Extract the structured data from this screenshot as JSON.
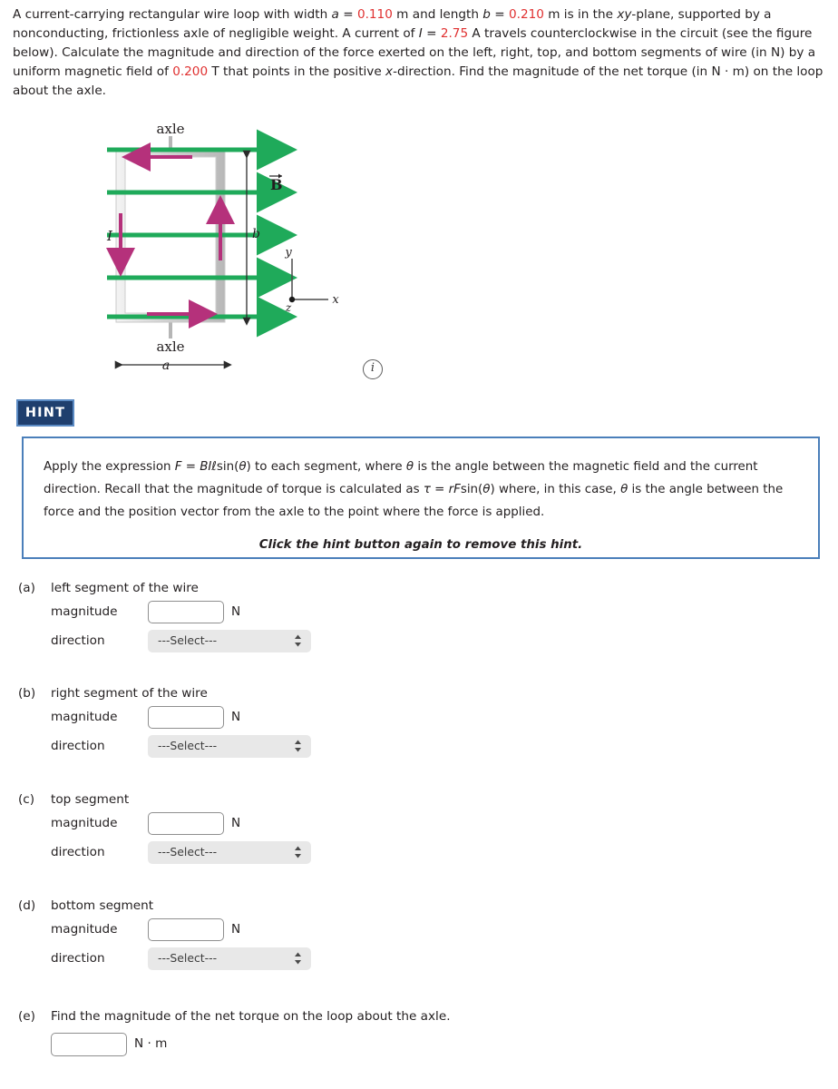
{
  "problem": {
    "segments": [
      {
        "t": "A current-carrying rectangular wire loop with width ",
        "s": "plain"
      },
      {
        "t": "a",
        "s": "ital"
      },
      {
        "t": " = ",
        "s": "plain"
      },
      {
        "t": "0.110",
        "s": "val"
      },
      {
        "t": " m and length ",
        "s": "plain"
      },
      {
        "t": "b",
        "s": "ital"
      },
      {
        "t": " = ",
        "s": "plain"
      },
      {
        "t": "0.210",
        "s": "val"
      },
      {
        "t": " m is in the ",
        "s": "plain"
      },
      {
        "t": "xy",
        "s": "ital"
      },
      {
        "t": "-plane, supported by a nonconducting, frictionless axle of negligible weight. A current of ",
        "s": "plain"
      },
      {
        "t": "I",
        "s": "ital"
      },
      {
        "t": " = ",
        "s": "plain"
      },
      {
        "t": "2.75",
        "s": "val"
      },
      {
        "t": " A travels counterclockwise in the circuit (see the figure below). Calculate the magnitude and direction of the force exerted on the left, right, top, and bottom segments of wire (in N) by a uniform magnetic field of ",
        "s": "plain"
      },
      {
        "t": "0.200",
        "s": "val"
      },
      {
        "t": " T that points in the positive ",
        "s": "plain"
      },
      {
        "t": "x",
        "s": "ital"
      },
      {
        "t": "-direction. Find the magnitude of the net torque (in N · m) on the loop about the axle.",
        "s": "plain"
      }
    ],
    "width_a": "0.110",
    "length_b": "0.210",
    "current_I": "2.75",
    "field_B": "0.200",
    "accent_value_color": "#e03131"
  },
  "figure": {
    "axle_top_label": "axle",
    "axle_bottom_label": "axle",
    "field_label": "B",
    "current_label": "I",
    "dim_width_label": "a",
    "dim_length_label": "b",
    "axis_x_label": "x",
    "axis_y_label": "y",
    "axis_z_label": "z",
    "field_arrow_count": 5,
    "field_color": "#1faa5a",
    "current_color": "#b5317b",
    "loop_frame_color": "#c9c9c9",
    "info_icon": "i"
  },
  "hint": {
    "badge_label": "HINT",
    "badge_bg": "#1f3f6e",
    "box_border": "#4b7fba",
    "body": [
      {
        "t": "Apply the expression ",
        "s": "plain"
      },
      {
        "t": "F",
        "s": "ital"
      },
      {
        "t": " = ",
        "s": "plain"
      },
      {
        "t": "BIℓ",
        "s": "ital"
      },
      {
        "t": "sin(",
        "s": "plain"
      },
      {
        "t": "θ",
        "s": "ital"
      },
      {
        "t": ") to each segment, where ",
        "s": "plain"
      },
      {
        "t": "θ",
        "s": "ital"
      },
      {
        "t": " is the angle between the magnetic field and the current direction. Recall that the magnitude of torque is calculated as ",
        "s": "plain"
      },
      {
        "t": "τ",
        "s": "ital"
      },
      {
        "t": " = ",
        "s": "plain"
      },
      {
        "t": "rF",
        "s": "ital"
      },
      {
        "t": "sin(",
        "s": "plain"
      },
      {
        "t": "θ",
        "s": "ital"
      },
      {
        "t": ") where, in this case, ",
        "s": "plain"
      },
      {
        "t": "θ",
        "s": "ital"
      },
      {
        "t": " is the angle between the force and the position vector from the axle to the point where the force is applied.",
        "s": "plain"
      }
    ],
    "footer": "Click the hint button again to remove this hint."
  },
  "parts": [
    {
      "letter": "(a)",
      "title": "left segment of the wire",
      "magnitude_label": "magnitude",
      "magnitude_value": "",
      "magnitude_unit": "N",
      "direction_label": "direction",
      "direction_value": "---Select---"
    },
    {
      "letter": "(b)",
      "title": "right segment of the wire",
      "magnitude_label": "magnitude",
      "magnitude_value": "",
      "magnitude_unit": "N",
      "direction_label": "direction",
      "direction_value": "---Select---"
    },
    {
      "letter": "(c)",
      "title": "top segment",
      "magnitude_label": "magnitude",
      "magnitude_value": "",
      "magnitude_unit": "N",
      "direction_label": "direction",
      "direction_value": "---Select---"
    },
    {
      "letter": "(d)",
      "title": "bottom segment",
      "magnitude_label": "magnitude",
      "magnitude_value": "",
      "magnitude_unit": "N",
      "direction_label": "direction",
      "direction_value": "---Select---"
    }
  ],
  "part_e": {
    "letter": "(e)",
    "title": "Find the magnitude of the net torque on the loop about the axle.",
    "value": "",
    "unit": "N · m"
  }
}
